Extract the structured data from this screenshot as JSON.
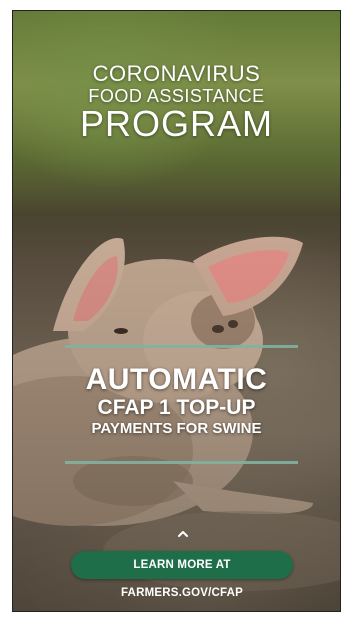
{
  "title": {
    "line1": "CORONAVIRUS",
    "line2": "FOOD ASSISTANCE",
    "line3": "PROGRAM"
  },
  "subtitle": {
    "line1": "AUTOMATIC",
    "line2": "CFAP 1 TOP-UP",
    "line3": "PAYMENTS FOR SWINE"
  },
  "cta": {
    "label": "LEARN MORE AT FARMERS.GOV/CFAP"
  },
  "icons": {
    "scroll_hint": "chevron-up-icon"
  },
  "colors": {
    "cta_background": "#1e6e4a",
    "divider": "#7fb3a0",
    "text": "#ffffff"
  }
}
